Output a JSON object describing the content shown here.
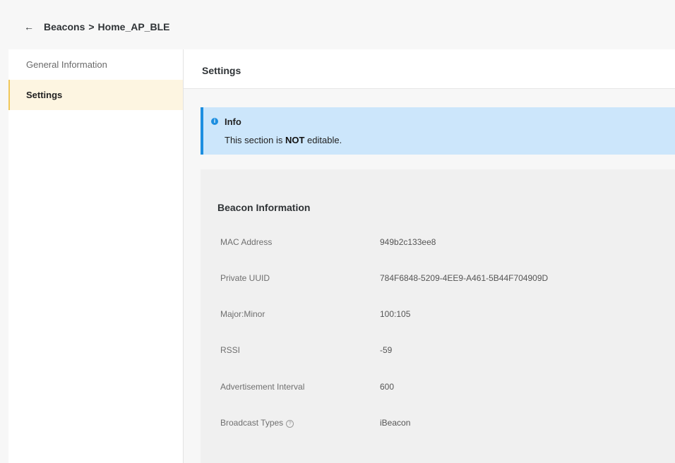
{
  "breadcrumb": {
    "parent": "Beacons",
    "separator": ">",
    "current": "Home_AP_BLE"
  },
  "sidebar": {
    "items": [
      {
        "label": "General Information",
        "active": false
      },
      {
        "label": "Settings",
        "active": true
      }
    ]
  },
  "main": {
    "title": "Settings",
    "info": {
      "title": "Info",
      "text_before": "This section is ",
      "text_bold": "NOT",
      "text_after": " editable."
    },
    "beacon": {
      "title": "Beacon Information",
      "rows": [
        {
          "label": "MAC Address",
          "value": "949b2c133ee8"
        },
        {
          "label": "Private UUID",
          "value": "784F6848-5209-4EE9-A461-5B44F704909D"
        },
        {
          "label": "Major:Minor",
          "value": "100:105"
        },
        {
          "label": "RSSI",
          "value": "-59"
        },
        {
          "label": "Advertisement Interval",
          "value": "600"
        },
        {
          "label": "Broadcast Types",
          "value": "iBeacon"
        }
      ]
    }
  },
  "icons": {
    "back": "arrow-left-icon",
    "info": "info-icon",
    "help": "help-circle-icon"
  },
  "colors": {
    "accent_active_bg": "#fdf5e1",
    "accent_active_border": "#f0c75a",
    "info_bg": "#cce6fb",
    "info_border": "#1c8ee0"
  }
}
